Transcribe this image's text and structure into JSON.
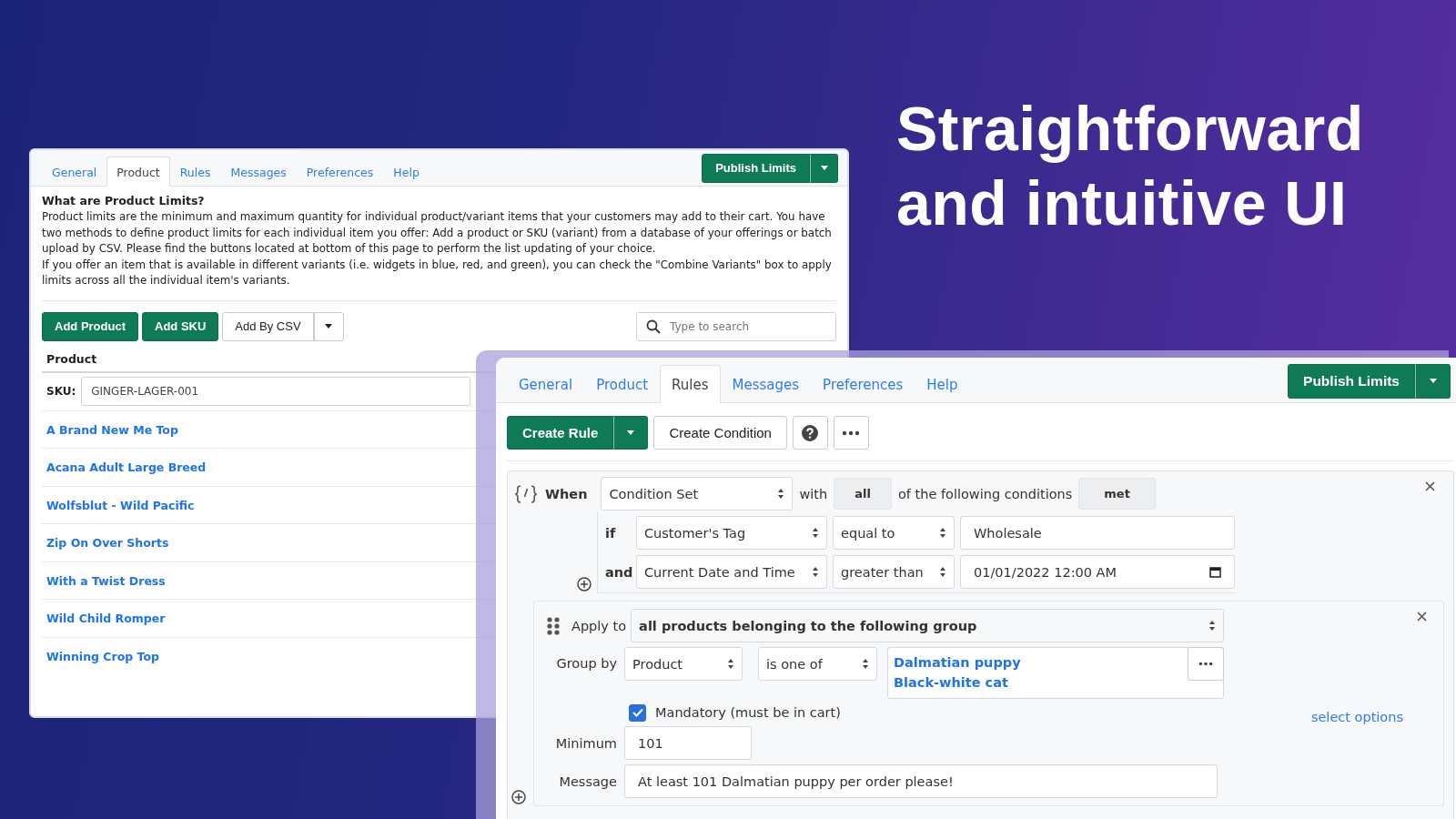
{
  "headline_lines": [
    "Straightforward",
    "and intuitive UI"
  ],
  "back_window": {
    "tabs": [
      {
        "label": "General",
        "selected": false
      },
      {
        "label": "Product",
        "selected": true
      },
      {
        "label": "Rules",
        "selected": false
      },
      {
        "label": "Messages",
        "selected": false
      },
      {
        "label": "Preferences",
        "selected": false
      },
      {
        "label": "Help",
        "selected": false
      }
    ],
    "publish_button": "Publish Limits",
    "intro_title": "What are Product Limits?",
    "intro_paragraphs": [
      "Product limits are the minimum and maximum quantity for individual product/variant items that your customers may add to their cart. You have two methods to define product limits for each individual item you offer: Add a product or SKU (variant) from a database of your offerings or batch upload by CSV. Please find the buttons located at bottom of this page to perform the list updating of your choice.",
      "If you offer an item that is available in different variants (i.e. widgets in blue, red, and green), you can check the \"Combine Variants\" box to apply limits across all the individual item's variants."
    ],
    "buttons": [
      {
        "label": "Add Product",
        "kind": "primary"
      },
      {
        "label": "Add SKU",
        "kind": "primary"
      },
      {
        "label": "Add By CSV",
        "kind": "split"
      }
    ],
    "search": {
      "placeholder": "Type to search"
    },
    "table": {
      "column": "Product",
      "sku": {
        "label": "SKU:",
        "value": "GINGER-LAGER-001"
      },
      "rows": [
        "A Brand New Me Top",
        "Acana Adult Large Breed",
        "Wolfsblut - Wild Pacific",
        "Zip On Over Shorts",
        "With a Twist Dress",
        "Wild Child Romper",
        "Winning Crop Top"
      ]
    }
  },
  "front_window": {
    "tabs": [
      {
        "label": "General",
        "selected": false
      },
      {
        "label": "Product",
        "selected": false
      },
      {
        "label": "Rules",
        "selected": true
      },
      {
        "label": "Messages",
        "selected": false
      },
      {
        "label": "Preferences",
        "selected": false
      },
      {
        "label": "Help",
        "selected": false
      }
    ],
    "publish_button": "Publish Limits",
    "toolbar": {
      "create_rule": "Create Rule",
      "create_condition": "Create Condition"
    },
    "condition": {
      "when": "When",
      "set": "Condition Set",
      "with": "with",
      "quantifier": "all",
      "following": "of the following conditions",
      "state": "met",
      "rows": [
        {
          "connector": "if",
          "field": "Customer's Tag",
          "operator": "equal to",
          "value": "Wholesale",
          "kind": "text"
        },
        {
          "connector": "and",
          "field": "Current Date and Time",
          "operator": "greater than",
          "value": "01/01/2022 12:00 AM",
          "kind": "datetime"
        }
      ]
    },
    "apply": {
      "label": "Apply to",
      "value": "all products belonging to the following group",
      "group_label": "Group by",
      "group_field": "Product",
      "group_operator": "is one of",
      "items": [
        "Dalmatian puppy",
        "Black-white cat"
      ],
      "mandatory": {
        "label": "Mandatory (must be in cart)",
        "checked": true
      },
      "options_link": "select options",
      "minimum": {
        "label": "Minimum",
        "value": "101"
      },
      "message": {
        "label": "Message",
        "value": "At least 101 Dalmatian puppy per order please!"
      }
    }
  }
}
